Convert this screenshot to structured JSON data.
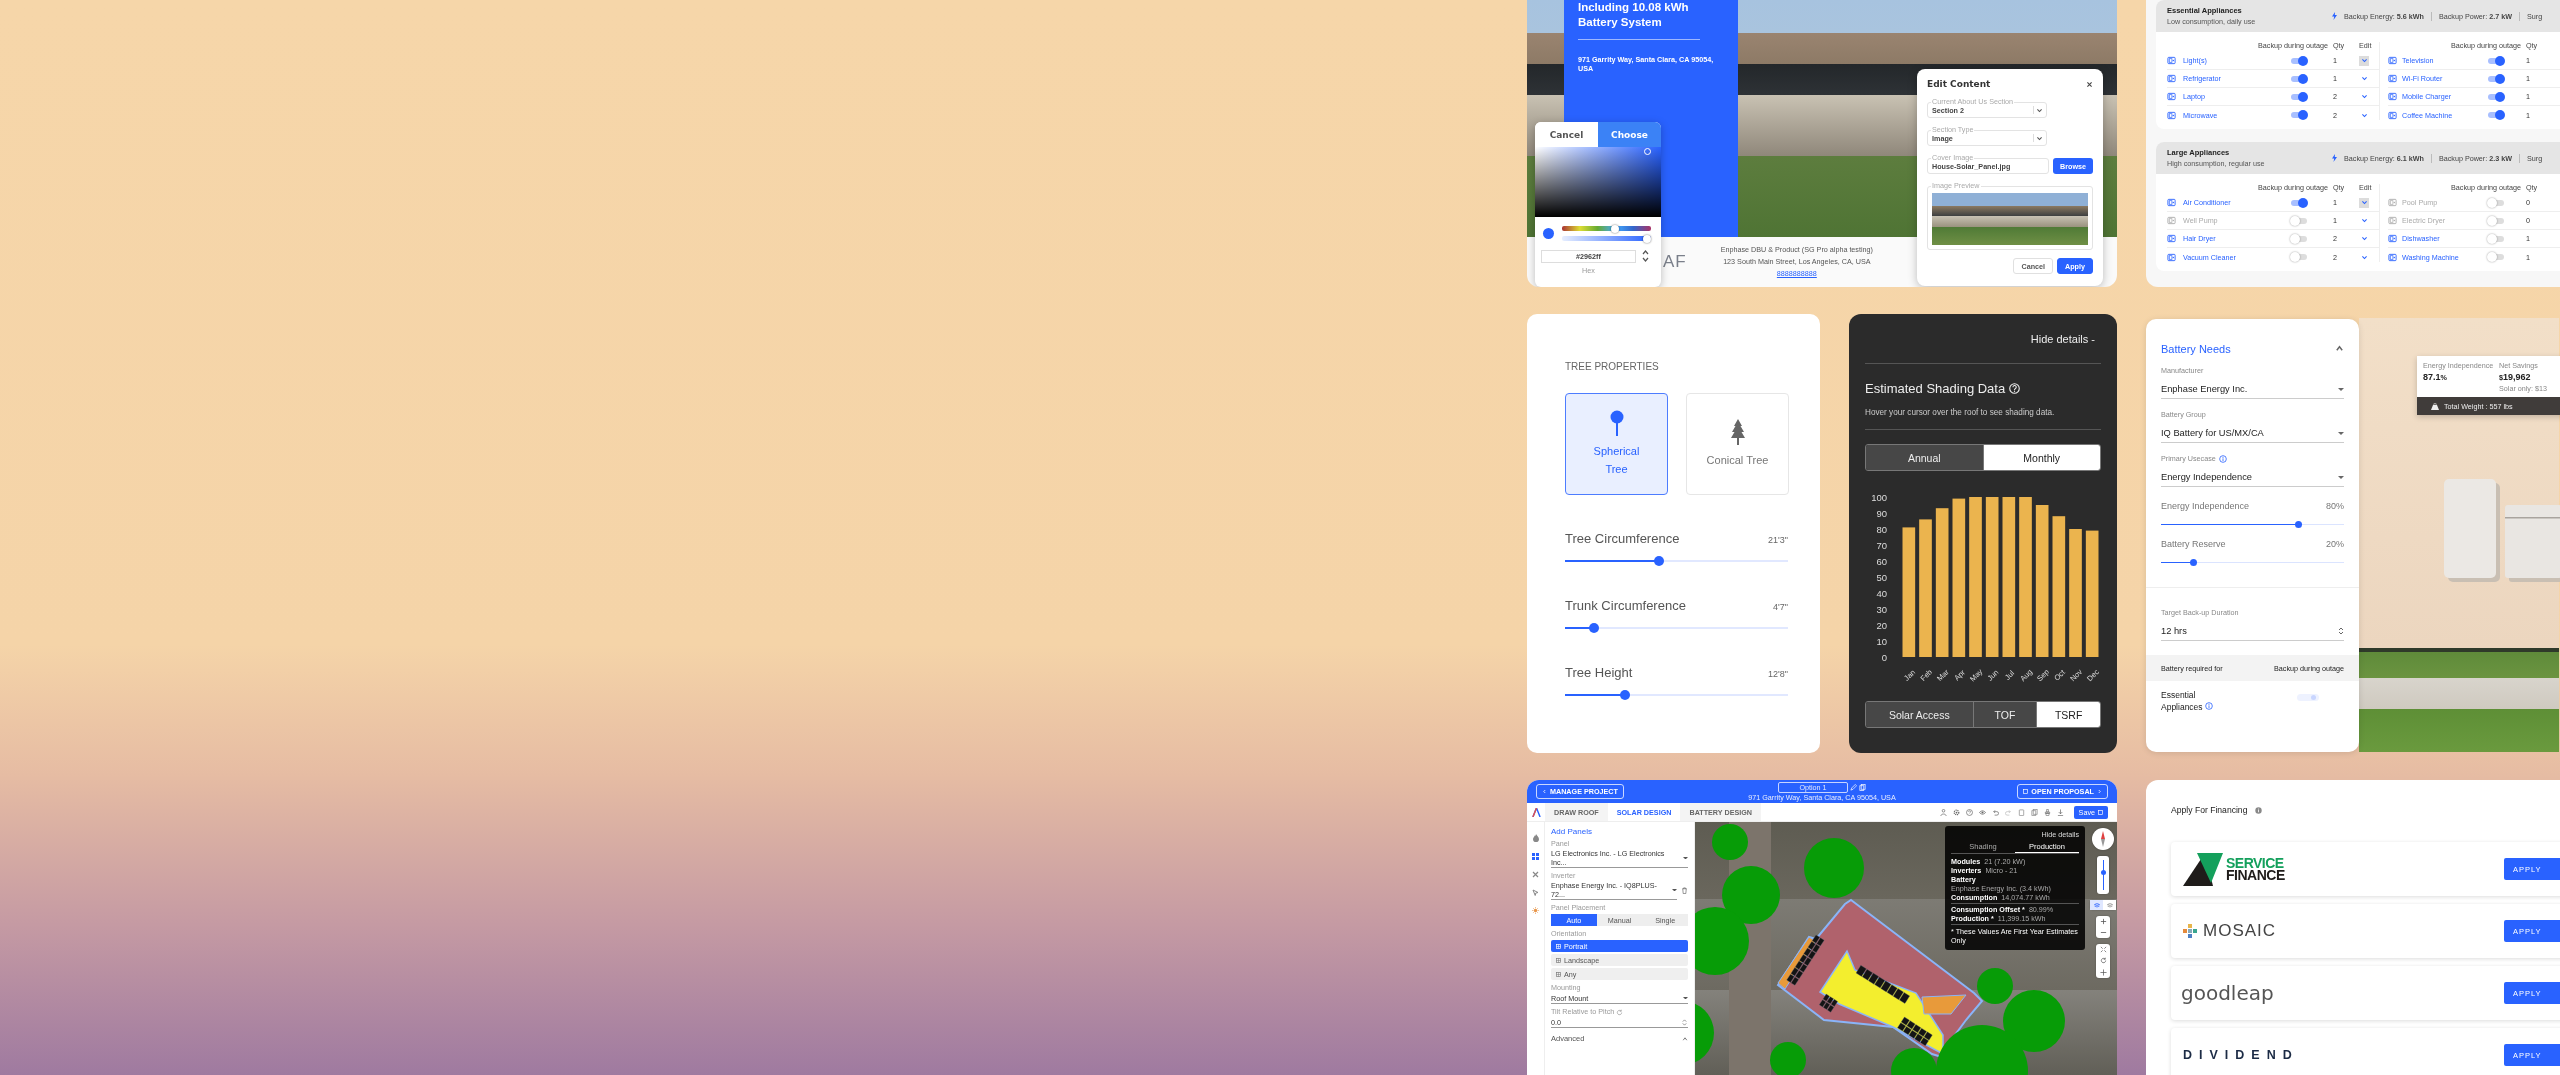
{
  "proposal": {
    "heading": "Including 10.08 kWh Battery System",
    "address": "971 Garrity Way, Santa Clara, CA 95054, USA",
    "logo": "AF",
    "company": "Enphase DBU & Product (SG Pro alpha testing)",
    "company_address": "123 South Main Street, Los Angeles, CA, USA",
    "phone": "8888888888",
    "color_picker": {
      "buttons": [
        {
          "label": "Cancel",
          "selected": false
        },
        {
          "label": "Choose",
          "selected": true
        }
      ],
      "hue_slider": {
        "level": 0.6
      },
      "alpha_slider": {
        "level": 1
      },
      "hex": "#2962ff",
      "hex_label": "Hex"
    },
    "dialog": {
      "title": "Edit Content",
      "fields": [
        {
          "kind": "select",
          "label": "Current About Us Section",
          "value": "Section 2"
        },
        {
          "kind": "select",
          "label": "Section Type",
          "value": "Image"
        },
        {
          "kind": "file",
          "label": "Cover Image",
          "value": "House-Solar_Panel.jpg",
          "button": "Browse"
        }
      ],
      "preview_label": "Image Preview",
      "buttons": [
        {
          "label": "Cancel",
          "primary": false
        },
        {
          "label": "Apply",
          "primary": true
        }
      ]
    }
  },
  "appliances": {
    "groups": [
      {
        "title": "Essential Appliances",
        "subtitle": "Low consumption, daily use",
        "stats": [
          "Backup Energy: **5.6 kWh**",
          "Backup Power: **2.7 kW**",
          "Surg"
        ],
        "halves": [
          {
            "columns": [
              "Backup during outage",
              "Qty",
              "Edit"
            ],
            "items": [
              {
                "name": "Light(s)",
                "backup": true,
                "qty": "1",
                "disabled": false,
                "hovered": true
              },
              {
                "name": "Refrigerator",
                "backup": true,
                "qty": "1",
                "disabled": false,
                "hovered": false
              },
              {
                "name": "Laptop",
                "backup": true,
                "qty": "2",
                "disabled": false,
                "hovered": false
              },
              {
                "name": "Microwave",
                "backup": true,
                "qty": "2",
                "disabled": false,
                "hovered": false
              }
            ]
          },
          {
            "columns": [
              "Backup during outage",
              "Qty"
            ],
            "items": [
              {
                "name": "Television",
                "backup": true,
                "qty": "1",
                "disabled": false
              },
              {
                "name": "Wi-Fi Router",
                "backup": true,
                "qty": "1",
                "disabled": false
              },
              {
                "name": "Mobile Charger",
                "backup": true,
                "qty": "1",
                "disabled": false
              },
              {
                "name": "Coffee Machine",
                "backup": true,
                "qty": "1",
                "disabled": false
              }
            ]
          }
        ]
      },
      {
        "title": "Large Appliances",
        "subtitle": "High consumption, regular use",
        "stats": [
          "Backup Energy: **6.1 kWh**",
          "Backup Power: **2.3 kW**",
          "Surg"
        ],
        "halves": [
          {
            "columns": [
              "Backup during outage",
              "Qty",
              "Edit"
            ],
            "items": [
              {
                "name": "Air Conditioner",
                "backup": true,
                "qty": "1",
                "disabled": false,
                "hovered": true
              },
              {
                "name": "Well Pump",
                "backup": false,
                "qty": "1",
                "disabled": true,
                "hovered": false
              },
              {
                "name": "Hair Dryer",
                "backup": false,
                "qty": "2",
                "disabled": false,
                "hovered": false
              },
              {
                "name": "Vacuum Cleaner",
                "backup": false,
                "qty": "2",
                "disabled": false,
                "hovered": false
              }
            ]
          },
          {
            "columns": [
              "Backup during outage",
              "Qty"
            ],
            "items": [
              {
                "name": "Pool Pump",
                "backup": false,
                "qty": "0",
                "disabled": true
              },
              {
                "name": "Electric Dryer",
                "backup": false,
                "qty": "0",
                "disabled": true
              },
              {
                "name": "Dishwasher",
                "backup": false,
                "qty": "1",
                "disabled": false
              },
              {
                "name": "Washing Machine",
                "backup": false,
                "qty": "1",
                "disabled": false
              }
            ]
          }
        ]
      }
    ]
  },
  "tree": {
    "title": "TREE PROPERTIES",
    "types": [
      {
        "kind": "spherical",
        "label": "Spherical Tree",
        "selected": true
      },
      {
        "kind": "conical",
        "label": "Conical Tree",
        "selected": false
      }
    ],
    "sliders": [
      {
        "label": "Tree Circumference",
        "reading": "21'3\"",
        "level": 0.42
      },
      {
        "label": "Trunk Circumference",
        "reading": "4'7\"",
        "level": 0.13
      },
      {
        "label": "Tree Height",
        "reading": "12'8\"",
        "level": 0.27
      }
    ]
  },
  "shading": {
    "toggle": "Hide details -",
    "title": "Estimated Shading Data",
    "hint": "Hover your cursor over the roof to see shading data.",
    "periods": [
      {
        "label": "Annual",
        "selected": false
      },
      {
        "label": "Monthly",
        "selected": true
      }
    ],
    "chart_data": {
      "type": "bar",
      "categories": [
        "Jan",
        "Feb",
        "Mar",
        "Apr",
        "May",
        "Jun",
        "Jul",
        "Aug",
        "Sep",
        "Oct",
        "Nov",
        "Dec"
      ],
      "values": [
        81,
        86,
        93,
        99,
        100,
        100,
        100,
        100,
        95,
        88,
        80,
        79
      ],
      "ylim": [
        0,
        100
      ],
      "yticks": [
        0,
        10,
        20,
        30,
        40,
        50,
        60,
        70,
        80,
        90,
        100
      ]
    },
    "metrics": [
      {
        "label": "Solar Access",
        "selected": false
      },
      {
        "label": "TOF",
        "selected": false
      },
      {
        "label": "TSRF",
        "selected": true
      }
    ]
  },
  "battery": {
    "title": "Battery Needs",
    "expanded": true,
    "fields": [
      {
        "label": "Manufacturer",
        "value": "Enphase Energy Inc.",
        "info": false
      },
      {
        "label": "Battery Group",
        "value": "IQ Battery for US/MX/CA",
        "info": false
      },
      {
        "label": "Primary Usecase",
        "value": "Energy Independence",
        "info": true
      }
    ],
    "sliders": [
      {
        "label": "Energy Independence",
        "reading": "80%",
        "level": 0.75
      },
      {
        "label": "Battery Reserve",
        "reading": "20%",
        "level": 0.18
      }
    ],
    "duration": {
      "label": "Target Back-up Duration",
      "value": "12 hrs"
    },
    "table": {
      "columns": [
        "Battery required for",
        "Backup during outage"
      ],
      "rows": [
        {
          "label": "Essential Appliances",
          "on": true,
          "disabled": true
        }
      ]
    },
    "photo_stats": {
      "items": [
        {
          "label": "Energy Independence",
          "value": "87.1",
          "suffix": "%"
        },
        {
          "label": "Net Savings",
          "value": "19,962",
          "prefix": "$",
          "note": "Solar only: $13"
        }
      ],
      "weight": "Total Weight : 557 lbs"
    }
  },
  "design": {
    "manage": "MANAGE PROJECT",
    "option": "Option 1",
    "address": "971 Garrity Way, Santa Clara, CA 95054, USA",
    "open": "OPEN PROPOSAL",
    "tabs": [
      {
        "label": "DRAW ROOF",
        "selected": false
      },
      {
        "label": "SOLAR DESIGN",
        "selected": true
      },
      {
        "label": "BATTERY DESIGN",
        "selected": false
      }
    ],
    "save": "Save",
    "rail": [
      {
        "selected": false
      },
      {
        "selected": true
      },
      {
        "selected": false
      },
      {
        "selected": false
      },
      {
        "selected": false
      }
    ],
    "sidebar": {
      "title": "Add Panels",
      "controls": [
        {
          "kind": "select",
          "label": "Panel",
          "value": "LG Electronics Inc. - LG Electronics Inc..."
        },
        {
          "kind": "removable",
          "label": "Inverter",
          "value": "Enphase Energy Inc. - IQ8PLUS-72..."
        },
        {
          "kind": "segmented",
          "label": "Panel Placement",
          "options": [
            {
              "label": "Auto",
              "selected": true
            },
            {
              "label": "Manual",
              "selected": false
            },
            {
              "label": "Single",
              "selected": false
            }
          ]
        },
        {
          "kind": "options",
          "label": "Orientation",
          "options": [
            {
              "label": "Portrait",
              "selected": true
            },
            {
              "label": "Landscape",
              "selected": false
            },
            {
              "label": "Any",
              "selected": false
            }
          ]
        },
        {
          "kind": "select",
          "label": "Mounting",
          "value": "Roof Mount"
        },
        {
          "kind": "number",
          "label": "Tilt Relative to Pitch",
          "value": "0.0"
        },
        {
          "kind": "section",
          "label": "Advanced"
        }
      ]
    },
    "map": {
      "info": {
        "toggle": "Hide details",
        "tabs": [
          {
            "label": "Shading",
            "selected": false
          },
          {
            "label": "Production",
            "selected": true
          }
        ],
        "sections": [
          {
            "rows": [
              {
                "label": "Modules",
                "value": "21 (7.20 kW)"
              },
              {
                "label": "Inverters",
                "value": "Micro - 21"
              },
              {
                "label": "Battery",
                "value": "Enphase Energy Inc. (3.4 kWh)"
              },
              {
                "label": "Consumption",
                "value": "14,074.77 kWh"
              }
            ]
          },
          {
            "rows": [
              {
                "label": "Consumption Offset *",
                "value": "80.99%"
              },
              {
                "label": "Production *",
                "value": "11,399.15 kWh"
              }
            ]
          }
        ],
        "note": "* These Values Are First Year Estimates Only"
      },
      "view_toggle": [
        {
          "selected": true
        },
        {
          "selected": false
        }
      ],
      "zoom_slider": {
        "level": 0.6
      }
    }
  },
  "financing": {
    "title": "Apply For Financing",
    "lenders": [
      {
        "kind": "service",
        "logo_lines": [
          "SERVICE",
          "FINANCE"
        ],
        "button": "APPLY"
      },
      {
        "kind": "mosaic",
        "logo_lines": [
          "MOSAIC"
        ],
        "button": "APPLY"
      },
      {
        "kind": "goodleap",
        "logo_lines": [
          "goodleap"
        ],
        "button": "APPLY"
      },
      {
        "kind": "dividend",
        "logo_lines": [
          "DIVIDEND"
        ],
        "button": "APPLY"
      }
    ]
  }
}
